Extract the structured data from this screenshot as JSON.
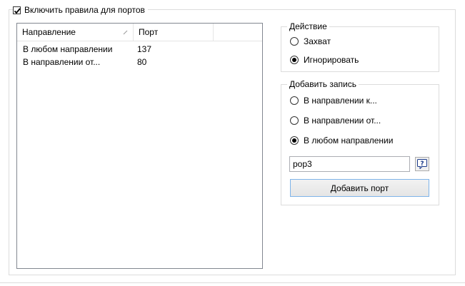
{
  "enable_rules": {
    "label": "Включить правила для портов",
    "checked": true
  },
  "list": {
    "columns": [
      "Направление",
      "Порт"
    ],
    "rows": [
      {
        "direction": "В любом направлении",
        "port": "137"
      },
      {
        "direction": "В направлении от...",
        "port": "80"
      }
    ]
  },
  "action": {
    "title": "Действие",
    "options": [
      {
        "label": "Захват",
        "checked": false
      },
      {
        "label": "Игнорировать",
        "checked": true
      }
    ]
  },
  "add_entry": {
    "title": "Добавить запись",
    "options": [
      {
        "label": "В направлении к...",
        "checked": false
      },
      {
        "label": "В направлении от...",
        "checked": false
      },
      {
        "label": "В любом направлении",
        "checked": true
      }
    ],
    "port_value": "pop3",
    "add_button_label": "Добавить порт"
  },
  "colors": {
    "border": "#dcdcdc",
    "list_border": "#828790",
    "button_focus_border": "#7eb4ea",
    "help_icon": "#1a3a8a"
  },
  "icons": {
    "help": "help-question-icon",
    "sort": "sort-arrow-icon",
    "check": "checkmark-icon"
  }
}
